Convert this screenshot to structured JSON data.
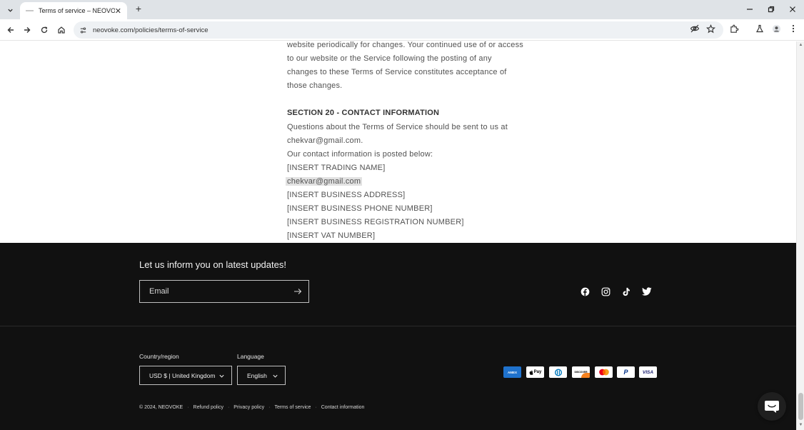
{
  "browser": {
    "tab_title": "Terms of service – NEOVOKE",
    "url": "neovoke.com/policies/terms-of-service"
  },
  "policy": {
    "lines_top": [
      "website periodically for changes. Your continued use of or access",
      "to our website or the Service following the posting of any",
      "changes to these Terms of Service constitutes acceptance of",
      "those changes."
    ],
    "section_heading": "SECTION 20 - CONTACT INFORMATION",
    "lines_contact": [
      "Questions about the Terms of Service should be sent to us at",
      "chekvar@gmail.com.",
      "Our contact information is posted below:",
      "[INSERT TRADING NAME]"
    ],
    "highlighted_email": "chekvar@gmail.com",
    "lines_bottom": [
      "[INSERT BUSINESS ADDRESS]",
      "[INSERT BUSINESS PHONE NUMBER]",
      "[INSERT BUSINESS REGISTRATION NUMBER]",
      "[INSERT VAT NUMBER]"
    ]
  },
  "footer": {
    "newsletter_title": "Let us inform you on latest updates!",
    "email_placeholder": "Email",
    "social": [
      "facebook-icon",
      "instagram-icon",
      "tiktok-icon",
      "twitter-icon"
    ],
    "country_label": "Country/region",
    "country_value": "USD $ | United Kingdom",
    "language_label": "Language",
    "language_value": "English",
    "payments": [
      {
        "name": "amex",
        "label": "AMEX",
        "bg": "#1f72cd",
        "fg": "#ffffff"
      },
      {
        "name": "apple-pay",
        "label": "Pay",
        "bg": "#ffffff",
        "fg": "#000000"
      },
      {
        "name": "diners-club",
        "label": "",
        "bg": "#ffffff",
        "fg": "#0079be"
      },
      {
        "name": "discover",
        "label": "DISCOVER",
        "bg": "#ffffff",
        "fg": "#000000"
      },
      {
        "name": "mastercard",
        "label": "",
        "bg": "#ffffff",
        "fg": "#000000"
      },
      {
        "name": "paypal",
        "label": "P",
        "bg": "#ffffff",
        "fg": "#003087"
      },
      {
        "name": "visa",
        "label": "VISA",
        "bg": "#ffffff",
        "fg": "#1a1f71"
      }
    ],
    "copyright": "© 2024, NEOVOKE",
    "legal_links": [
      "Refund policy",
      "Privacy policy",
      "Terms of service",
      "Contact information"
    ]
  }
}
